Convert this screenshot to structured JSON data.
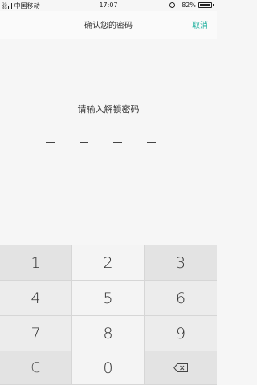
{
  "status_bar": {
    "network_type": "2G/4G",
    "carrier": "中国移动",
    "time": "17:07",
    "battery_percent": "82%",
    "battery_level": 0.82
  },
  "header": {
    "title": "确认您的密码",
    "cancel_label": "取消"
  },
  "prompt": {
    "text": "请输入解锁密码"
  },
  "passcode": {
    "length": 4,
    "entered": 0
  },
  "keypad": {
    "keys": [
      "1",
      "2",
      "3",
      "4",
      "5",
      "6",
      "7",
      "8",
      "9",
      "C",
      "0"
    ],
    "backspace_icon": "backspace-icon"
  },
  "colors": {
    "accent": "#2fb5a5"
  }
}
